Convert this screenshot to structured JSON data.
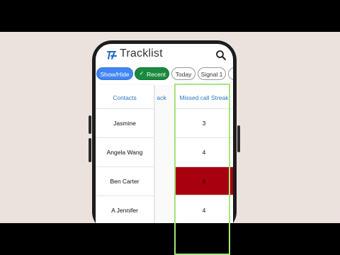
{
  "app": {
    "title": "Tracklist",
    "logo_icon": "tracklist-logo-icon",
    "search_icon": "search-icon"
  },
  "filters": [
    {
      "label": "Show/Hide"
    },
    {
      "label": "Recent",
      "icon": "check-icon"
    },
    {
      "label": "Today"
    },
    {
      "label": "Signal 1"
    }
  ],
  "table": {
    "headers": {
      "contacts": "Contacts",
      "mid": "ack",
      "streak": "Missed call Streak"
    },
    "rows": [
      {
        "contact": "Jasmine",
        "streak": "3"
      },
      {
        "contact": "Angela Wang",
        "streak": "4"
      },
      {
        "contact": "Ben Carter",
        "streak": "6"
      },
      {
        "contact": "A Jennifer",
        "streak": "4"
      }
    ]
  },
  "colors": {
    "accent": "#4285f4",
    "recent_chip": "#1a8a3e",
    "highlight": "#a8000f",
    "focus": "#a6e57c"
  }
}
